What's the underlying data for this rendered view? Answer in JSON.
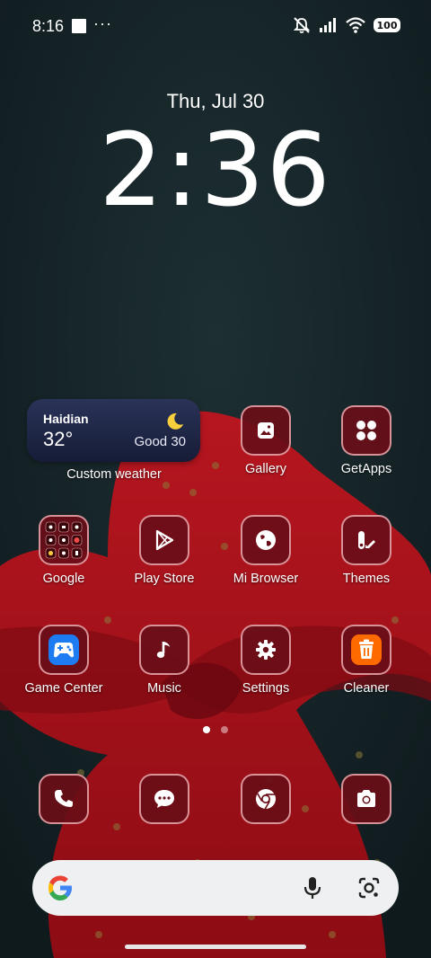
{
  "status_bar": {
    "time": "8:16",
    "overflow": "···",
    "battery": "100",
    "icons": [
      "notification-square-icon",
      "silent-icon",
      "signal-icon",
      "wifi-icon",
      "battery-icon"
    ]
  },
  "lock_clock": {
    "date": "Thu, Jul 30",
    "time": "2:36"
  },
  "weather_widget": {
    "city": "Haidian",
    "temperature": "32°",
    "air_quality": "Good 30",
    "label": "Custom weather",
    "icon": "moon-icon"
  },
  "apps": {
    "gallery": "Gallery",
    "getapps": "GetApps",
    "google": "Google",
    "play_store": "Play Store",
    "mi_browser": "Mi Browser",
    "themes": "Themes",
    "game_center": "Game Center",
    "music": "Music",
    "settings": "Settings",
    "cleaner": "Cleaner"
  },
  "dock": [
    "phone-icon",
    "messages-icon",
    "chrome-icon",
    "camera-icon"
  ],
  "page_indicator": {
    "pages": 2,
    "current": 1
  },
  "search_bar": {
    "icons": [
      "google-g-icon",
      "mic-icon",
      "lens-icon"
    ]
  },
  "colors": {
    "icon_bg": "#690e18",
    "icon_border": "#ebaaaf",
    "wallpaper_dark": "#17252a",
    "wallpaper_red": "#b5161f"
  }
}
